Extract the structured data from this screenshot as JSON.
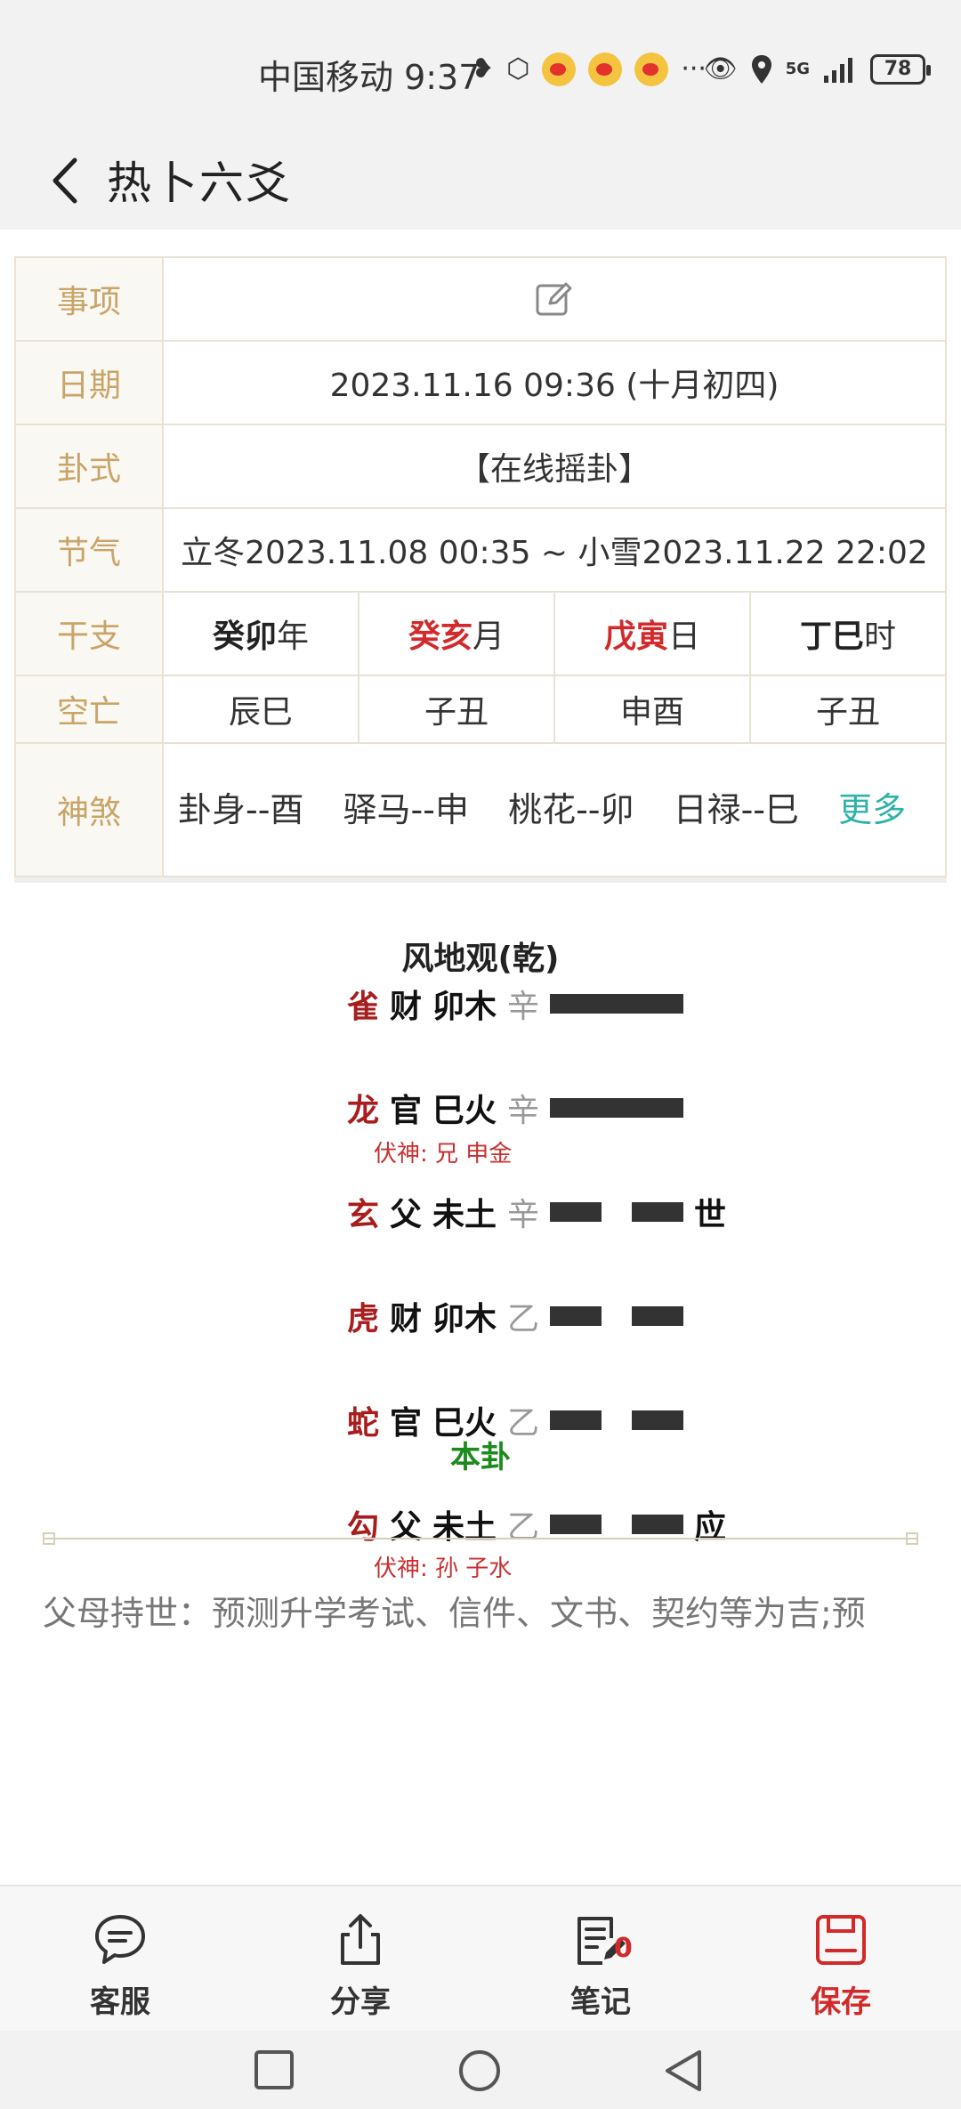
{
  "status": {
    "carrier_time": "中国移动 9:37",
    "battery": "78",
    "more": "···",
    "network": "5G"
  },
  "header": {
    "title": "热卜六爻"
  },
  "table": {
    "rows": [
      {
        "label": "事项"
      },
      {
        "label": "日期",
        "value": "2023.11.16 09:36 (十月初四)"
      },
      {
        "label": "卦式",
        "value": "【在线摇卦】"
      },
      {
        "label": "节气",
        "value": "立冬2023.11.08 00:35 ~ 小雪2023.11.22 22:02"
      }
    ],
    "ganzhi": {
      "label": "干支",
      "year": {
        "gz": "癸卯",
        "unit": "年"
      },
      "month": {
        "gz": "癸亥",
        "unit": "月"
      },
      "day": {
        "gz": "戊寅",
        "unit": "日"
      },
      "hour": {
        "gz": "丁巳",
        "unit": "时"
      }
    },
    "kongwang": {
      "label": "空亡",
      "values": [
        "辰巳",
        "子丑",
        "申酉",
        "子丑"
      ]
    },
    "shensha": {
      "label": "神煞",
      "items": [
        "卦身--酉",
        "驿马--申",
        "桃花--卯",
        "日禄--巳"
      ],
      "more": "更多"
    }
  },
  "hexagram": {
    "name": "风地观(乾)",
    "lines": [
      {
        "spirit": "雀",
        "relation": "财",
        "branch": "卯木",
        "stem": "辛",
        "yin": false,
        "mark": ""
      },
      {
        "spirit": "龙",
        "relation": "官",
        "branch": "巳火",
        "stem": "辛",
        "yin": false,
        "mark": ""
      },
      {
        "spirit": "玄",
        "relation": "父",
        "branch": "未土",
        "stem": "辛",
        "yin": true,
        "mark": "世"
      },
      {
        "spirit": "虎",
        "relation": "财",
        "branch": "卯木",
        "stem": "乙",
        "yin": true,
        "mark": ""
      },
      {
        "spirit": "蛇",
        "relation": "官",
        "branch": "巳火",
        "stem": "乙",
        "yin": true,
        "mark": ""
      },
      {
        "spirit": "勾",
        "relation": "父",
        "branch": "未土",
        "stem": "乙",
        "yin": true,
        "mark": "应"
      }
    ],
    "fushen": [
      {
        "text": "伏神: 兄  申金"
      },
      {
        "text": "伏神: 孙  子水"
      }
    ],
    "caption": "本卦"
  },
  "description": "父母持世：预测升学考试、信件、文书、契约等为吉;预",
  "toolbar": {
    "service": "客服",
    "share": "分享",
    "notes": "笔记",
    "notes_badge": "0",
    "save": "保存"
  },
  "colors": {
    "accent_red": "#d22a2a",
    "label_gold": "#c9a468",
    "link_teal": "#2fb3a6",
    "spirit_red": "#a81d1d",
    "caption_green": "#1c8b1c"
  }
}
